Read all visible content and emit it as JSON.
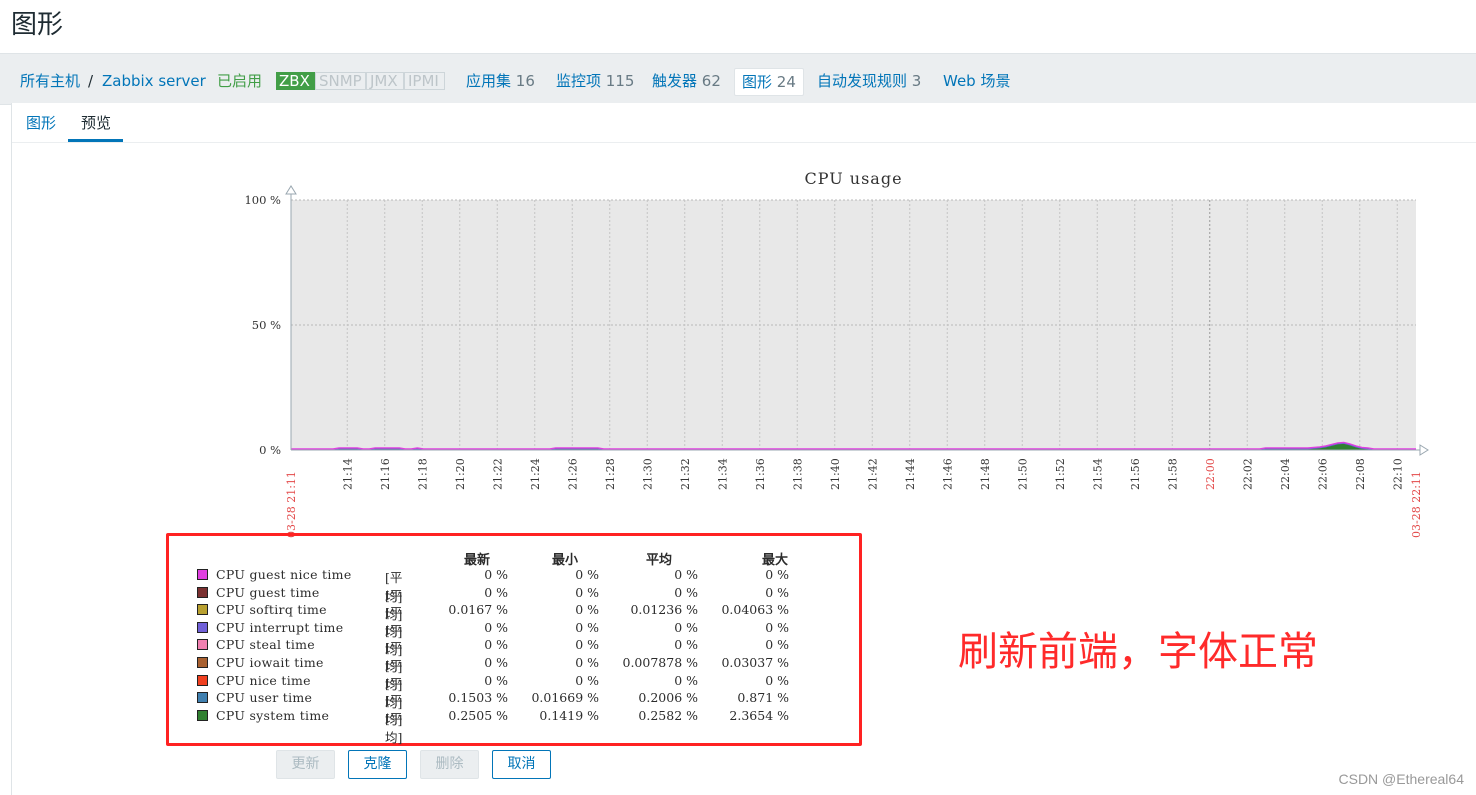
{
  "page": {
    "title": "图形"
  },
  "host_nav": {
    "all_hosts": "所有主机",
    "separator": "/",
    "host": "Zabbix server",
    "status": "已启用",
    "availability": [
      {
        "label": "ZBX",
        "state": "on"
      },
      {
        "label": "SNMP",
        "state": "off"
      },
      {
        "label": "JMX",
        "state": "off"
      },
      {
        "label": "IPMI",
        "state": "off"
      }
    ],
    "links": [
      {
        "label": "应用集",
        "count": "16"
      },
      {
        "label": "监控项",
        "count": "115"
      },
      {
        "label": "触发器",
        "count": "62"
      },
      {
        "label": "图形",
        "count": "24"
      },
      {
        "label": "自动发现规则",
        "count": "3"
      },
      {
        "label": "Web 场景",
        "count": ""
      }
    ],
    "active_link": "图形"
  },
  "tabs": [
    {
      "label": "图形"
    },
    {
      "label": "预览"
    }
  ],
  "active_tab": "预览",
  "chart_data": {
    "type": "area",
    "title": "CPU usage",
    "y_unit": "%",
    "ylim": [
      0,
      100
    ],
    "y_ticks": [
      "100 %",
      "50 %",
      "0 %"
    ],
    "x_start_label": "03-28 21:11",
    "x_end_label": "03-28 22:11",
    "x_ticks": [
      "21:14",
      "21:16",
      "21:18",
      "21:20",
      "21:22",
      "21:24",
      "21:26",
      "21:28",
      "21:30",
      "21:32",
      "21:34",
      "21:36",
      "21:38",
      "21:40",
      "21:42",
      "21:44",
      "21:46",
      "21:48",
      "21:50",
      "21:52",
      "21:54",
      "21:56",
      "21:58",
      "22:00",
      "22:02",
      "22:04",
      "22:06",
      "22:08",
      "22:10"
    ],
    "x_highlight_tick": "22:00",
    "grid": true,
    "legend_headers": [
      "最新",
      "最小",
      "平均",
      "最大"
    ],
    "series": [
      {
        "name": "CPU guest nice time",
        "func": "[平均]",
        "color": "#e040e0",
        "last": "0 %",
        "min": "0 %",
        "avg": "0 %",
        "max": "0 %"
      },
      {
        "name": "CPU guest time",
        "func": "[平均]",
        "color": "#7a3030",
        "last": "0 %",
        "min": "0 %",
        "avg": "0 %",
        "max": "0 %"
      },
      {
        "name": "CPU softirq time",
        "func": "[平均]",
        "color": "#b8a030",
        "last": "0.0167 %",
        "min": "0 %",
        "avg": "0.01236 %",
        "max": "0.04063 %"
      },
      {
        "name": "CPU interrupt time",
        "func": "[平均]",
        "color": "#7060d8",
        "last": "0 %",
        "min": "0 %",
        "avg": "0 %",
        "max": "0 %"
      },
      {
        "name": "CPU steal time",
        "func": "[平均]",
        "color": "#f080b0",
        "last": "0 %",
        "min": "0 %",
        "avg": "0 %",
        "max": "0 %"
      },
      {
        "name": "CPU iowait time",
        "func": "[平均]",
        "color": "#a86030",
        "last": "0 %",
        "min": "0 %",
        "avg": "0.007878 %",
        "max": "0.03037 %"
      },
      {
        "name": "CPU nice time",
        "func": "[平均]",
        "color": "#f04020",
        "last": "0 %",
        "min": "0 %",
        "avg": "0 %",
        "max": "0 %"
      },
      {
        "name": "CPU user time",
        "func": "[平均]",
        "color": "#4080b0",
        "last": "0.1503 %",
        "min": "0.01669 %",
        "avg": "0.2006 %",
        "max": "0.871 %"
      },
      {
        "name": "CPU system time",
        "func": "[平均]",
        "color": "#308030",
        "last": "0.2505 %",
        "min": "0.1419 %",
        "avg": "0.2582 %",
        "max": "2.3654 %"
      }
    ],
    "total_samples": [
      0.4,
      0.4,
      0.4,
      0.4,
      0.4,
      0.4,
      0.4,
      0.4,
      0.8,
      0.8,
      0.8,
      0.8,
      0.4,
      0.4,
      0.8,
      0.8,
      0.8,
      0.8,
      0.8,
      0.4,
      0.4,
      0.8,
      0.4,
      0.4,
      0.4,
      0.4,
      0.4,
      0.4,
      0.4,
      0.4,
      0.4,
      0.4,
      0.4,
      0.4,
      0.4,
      0.4,
      0.4,
      0.4,
      0.4,
      0.4,
      0.4,
      0.4,
      0.4,
      0.4,
      0.8,
      0.8,
      0.8,
      0.8,
      0.8,
      0.8,
      0.8,
      0.8,
      0.4,
      0.4,
      0.4,
      0.4,
      0.4,
      0.4,
      0.4,
      0.4,
      0.4,
      0.4,
      0.4,
      0.4,
      0.4,
      0.4,
      0.4,
      0.4,
      0.4,
      0.4,
      0.4,
      0.4,
      0.4,
      0.4,
      0.4,
      0.4,
      0.4,
      0.4,
      0.4,
      0.4,
      0.4,
      0.4,
      0.4,
      0.4,
      0.4,
      0.4,
      0.4,
      0.4,
      0.4,
      0.4,
      0.4,
      0.4,
      0.4,
      0.4,
      0.4,
      0.4,
      0.4,
      0.4,
      0.4,
      0.4,
      0.4,
      0.4,
      0.4,
      0.4,
      0.4,
      0.4,
      0.4,
      0.4,
      0.4,
      0.4,
      0.4,
      0.4,
      0.4,
      0.4,
      0.4,
      0.4,
      0.4,
      0.4,
      0.4,
      0.4,
      0.4,
      0.4,
      0.4,
      0.4,
      0.4,
      0.4,
      0.4,
      0.4,
      0.4,
      0.4,
      0.4,
      0.4,
      0.4,
      0.4,
      0.4,
      0.4,
      0.4,
      0.4,
      0.4,
      0.4,
      0.4,
      0.4,
      0.4,
      0.4,
      0.4,
      0.4,
      0.4,
      0.4,
      0.4,
      0.4,
      0.4,
      0.4,
      0.4,
      0.4,
      0.4,
      0.4,
      0.4,
      0.4,
      0.4,
      0.4,
      0.4,
      0.4,
      0.8,
      0.8,
      0.8,
      0.8,
      0.8,
      0.8,
      0.8,
      0.8,
      1.0,
      1.2,
      1.6,
      2.2,
      2.8,
      3.0,
      2.4,
      1.6,
      1.0,
      0.8,
      0.4,
      0.4,
      0.4,
      0.4,
      0.4,
      0.4,
      0.4,
      0.4
    ]
  },
  "annotation": "刷新前端，字体正常",
  "buttons": [
    {
      "label": "更新",
      "state": "disabled"
    },
    {
      "label": "克隆",
      "state": "enabled"
    },
    {
      "label": "删除",
      "state": "disabled"
    },
    {
      "label": "取消",
      "state": "enabled"
    }
  ],
  "watermark": "CSDN @Ethereal64"
}
